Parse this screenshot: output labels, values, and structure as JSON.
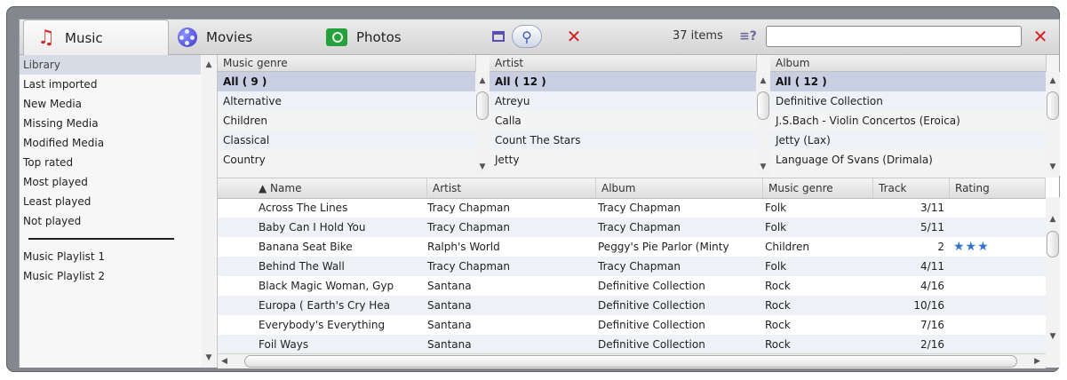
{
  "tabs": [
    {
      "label": "Music",
      "icon": "music-note-icon",
      "active": true
    },
    {
      "label": "Movies",
      "icon": "film-reel-icon",
      "active": false
    },
    {
      "label": "Photos",
      "icon": "camera-icon",
      "active": false
    }
  ],
  "toolbar": {
    "item_count": "37 items",
    "filter_label": "≡?",
    "search_value": "",
    "search_placeholder": ""
  },
  "sidebar": {
    "items": [
      "Library",
      "Last imported",
      "New Media",
      "Missing Media",
      "Modified Media",
      "Top rated",
      "Most played",
      "Least played",
      "Not played"
    ],
    "playlists": [
      "Music Playlist 1",
      "Music Playlist 2"
    ]
  },
  "browse": {
    "genre": {
      "header": "Music genre",
      "items": [
        "All ( 9 )",
        "Alternative",
        "Children",
        "Classical",
        "Country"
      ]
    },
    "artist": {
      "header": "Artist",
      "items": [
        "All ( 12 )",
        "Atreyu",
        "Calla",
        "Count The Stars",
        "Jetty"
      ]
    },
    "album": {
      "header": "Album",
      "items": [
        "All ( 12 )",
        "Definitive Collection",
        "J.S.Bach - Violin Concertos (Eroica)",
        "Jetty (Lax)",
        "Language Of Svans (Drimala)"
      ]
    }
  },
  "table": {
    "columns": [
      "▲  Name",
      "Artist",
      "Album",
      "Music genre",
      "Track",
      "Rating"
    ],
    "rows": [
      {
        "name": "Across The Lines",
        "artist": "Tracy Chapman",
        "album": "Tracy Chapman",
        "genre": "Folk",
        "track": "3/11",
        "rating": ""
      },
      {
        "name": "Baby Can I Hold You",
        "artist": "Tracy Chapman",
        "album": "Tracy Chapman",
        "genre": "Folk",
        "track": "5/11",
        "rating": ""
      },
      {
        "name": "Banana Seat Bike",
        "artist": "Ralph's World",
        "album": "Peggy's Pie Parlor (Minty",
        "genre": "Children",
        "track": "2",
        "rating": "★★★"
      },
      {
        "name": "Behind The Wall",
        "artist": "Tracy Chapman",
        "album": "Tracy Chapman",
        "genre": "Folk",
        "track": "4/11",
        "rating": ""
      },
      {
        "name": "Black Magic Woman, Gyp",
        "artist": "Santana",
        "album": "Definitive Collection",
        "genre": "Rock",
        "track": "4/16",
        "rating": ""
      },
      {
        "name": "Europa ( Earth's Cry Hea",
        "artist": "Santana",
        "album": "Definitive Collection",
        "genre": "Rock",
        "track": "10/16",
        "rating": ""
      },
      {
        "name": "Everybody's Everything",
        "artist": "Santana",
        "album": "Definitive Collection",
        "genre": "Rock",
        "track": "7/16",
        "rating": ""
      },
      {
        "name": "Foil Ways",
        "artist": "Santana",
        "album": "Definitive Collection",
        "genre": "Rock",
        "track": "2/16",
        "rating": ""
      }
    ]
  },
  "colors": {
    "accent_close": "#d42222",
    "star": "#2f74d0",
    "selection": "#c9cfe3"
  }
}
